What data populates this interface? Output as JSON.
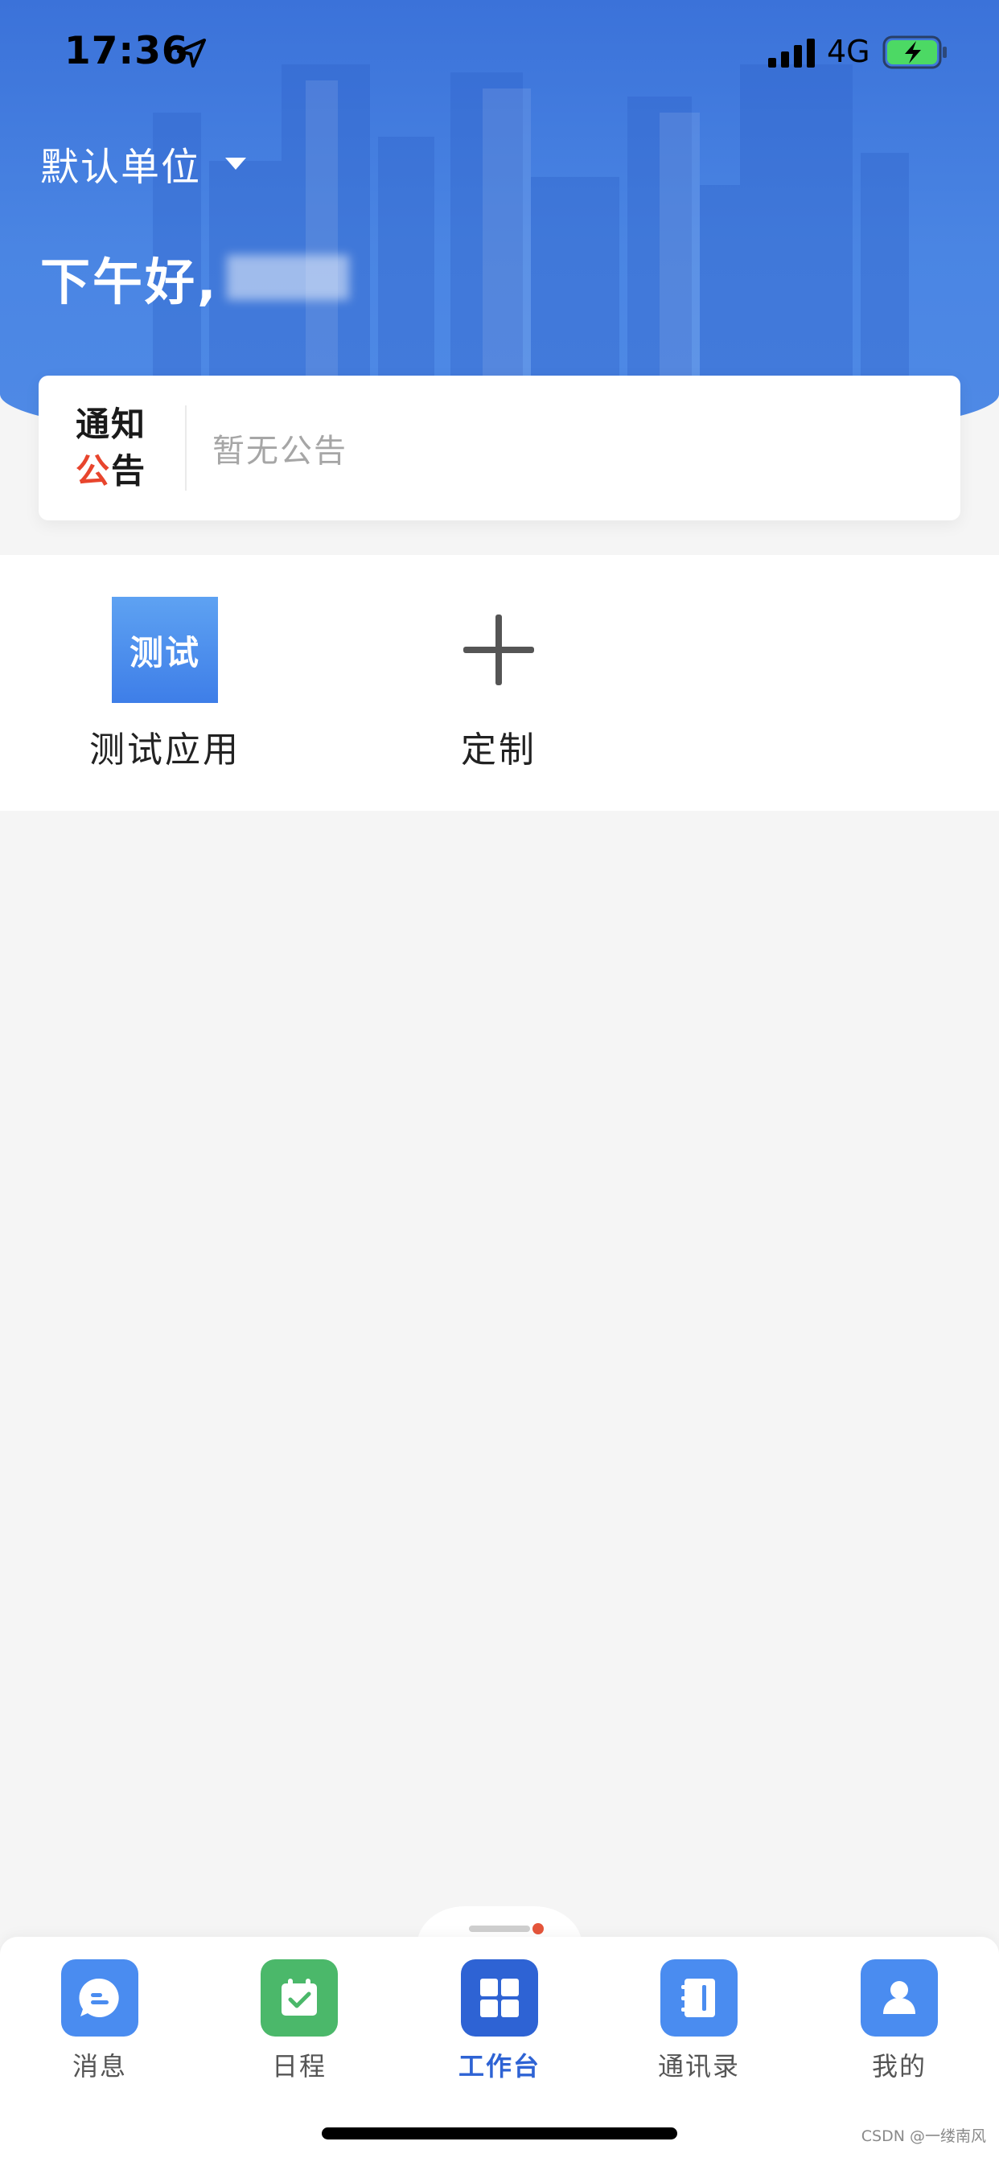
{
  "status_bar": {
    "time": "17:36",
    "network": "4G"
  },
  "header": {
    "unit_label": "默认单位",
    "greeting": "下午好,"
  },
  "notice": {
    "logo_line1": "通知",
    "logo_line2_accent": "公",
    "logo_line2_rest": "告",
    "text": "暂无公告"
  },
  "apps": [
    {
      "label": "测试应用",
      "icon_text": "测试",
      "icon": "test-app-icon"
    },
    {
      "label": "定制",
      "icon": "plus-icon"
    }
  ],
  "tabs": [
    {
      "label": "消息",
      "icon": "message-icon",
      "color": "#4a8cf0",
      "active": false
    },
    {
      "label": "日程",
      "icon": "calendar-check-icon",
      "color": "#4bb86a",
      "active": false
    },
    {
      "label": "工作台",
      "icon": "grid-icon",
      "color": "#2e63d4",
      "active": true
    },
    {
      "label": "通讯录",
      "icon": "address-book-icon",
      "color": "#4a8cf0",
      "active": false
    },
    {
      "label": "我的",
      "icon": "user-icon",
      "color": "#4a8cf0",
      "active": false
    }
  ],
  "watermark": "CSDN @一缕南风",
  "colors": {
    "header_blue": "#3b72d9",
    "accent_red": "#e8452d",
    "active_blue": "#2e63d4"
  }
}
